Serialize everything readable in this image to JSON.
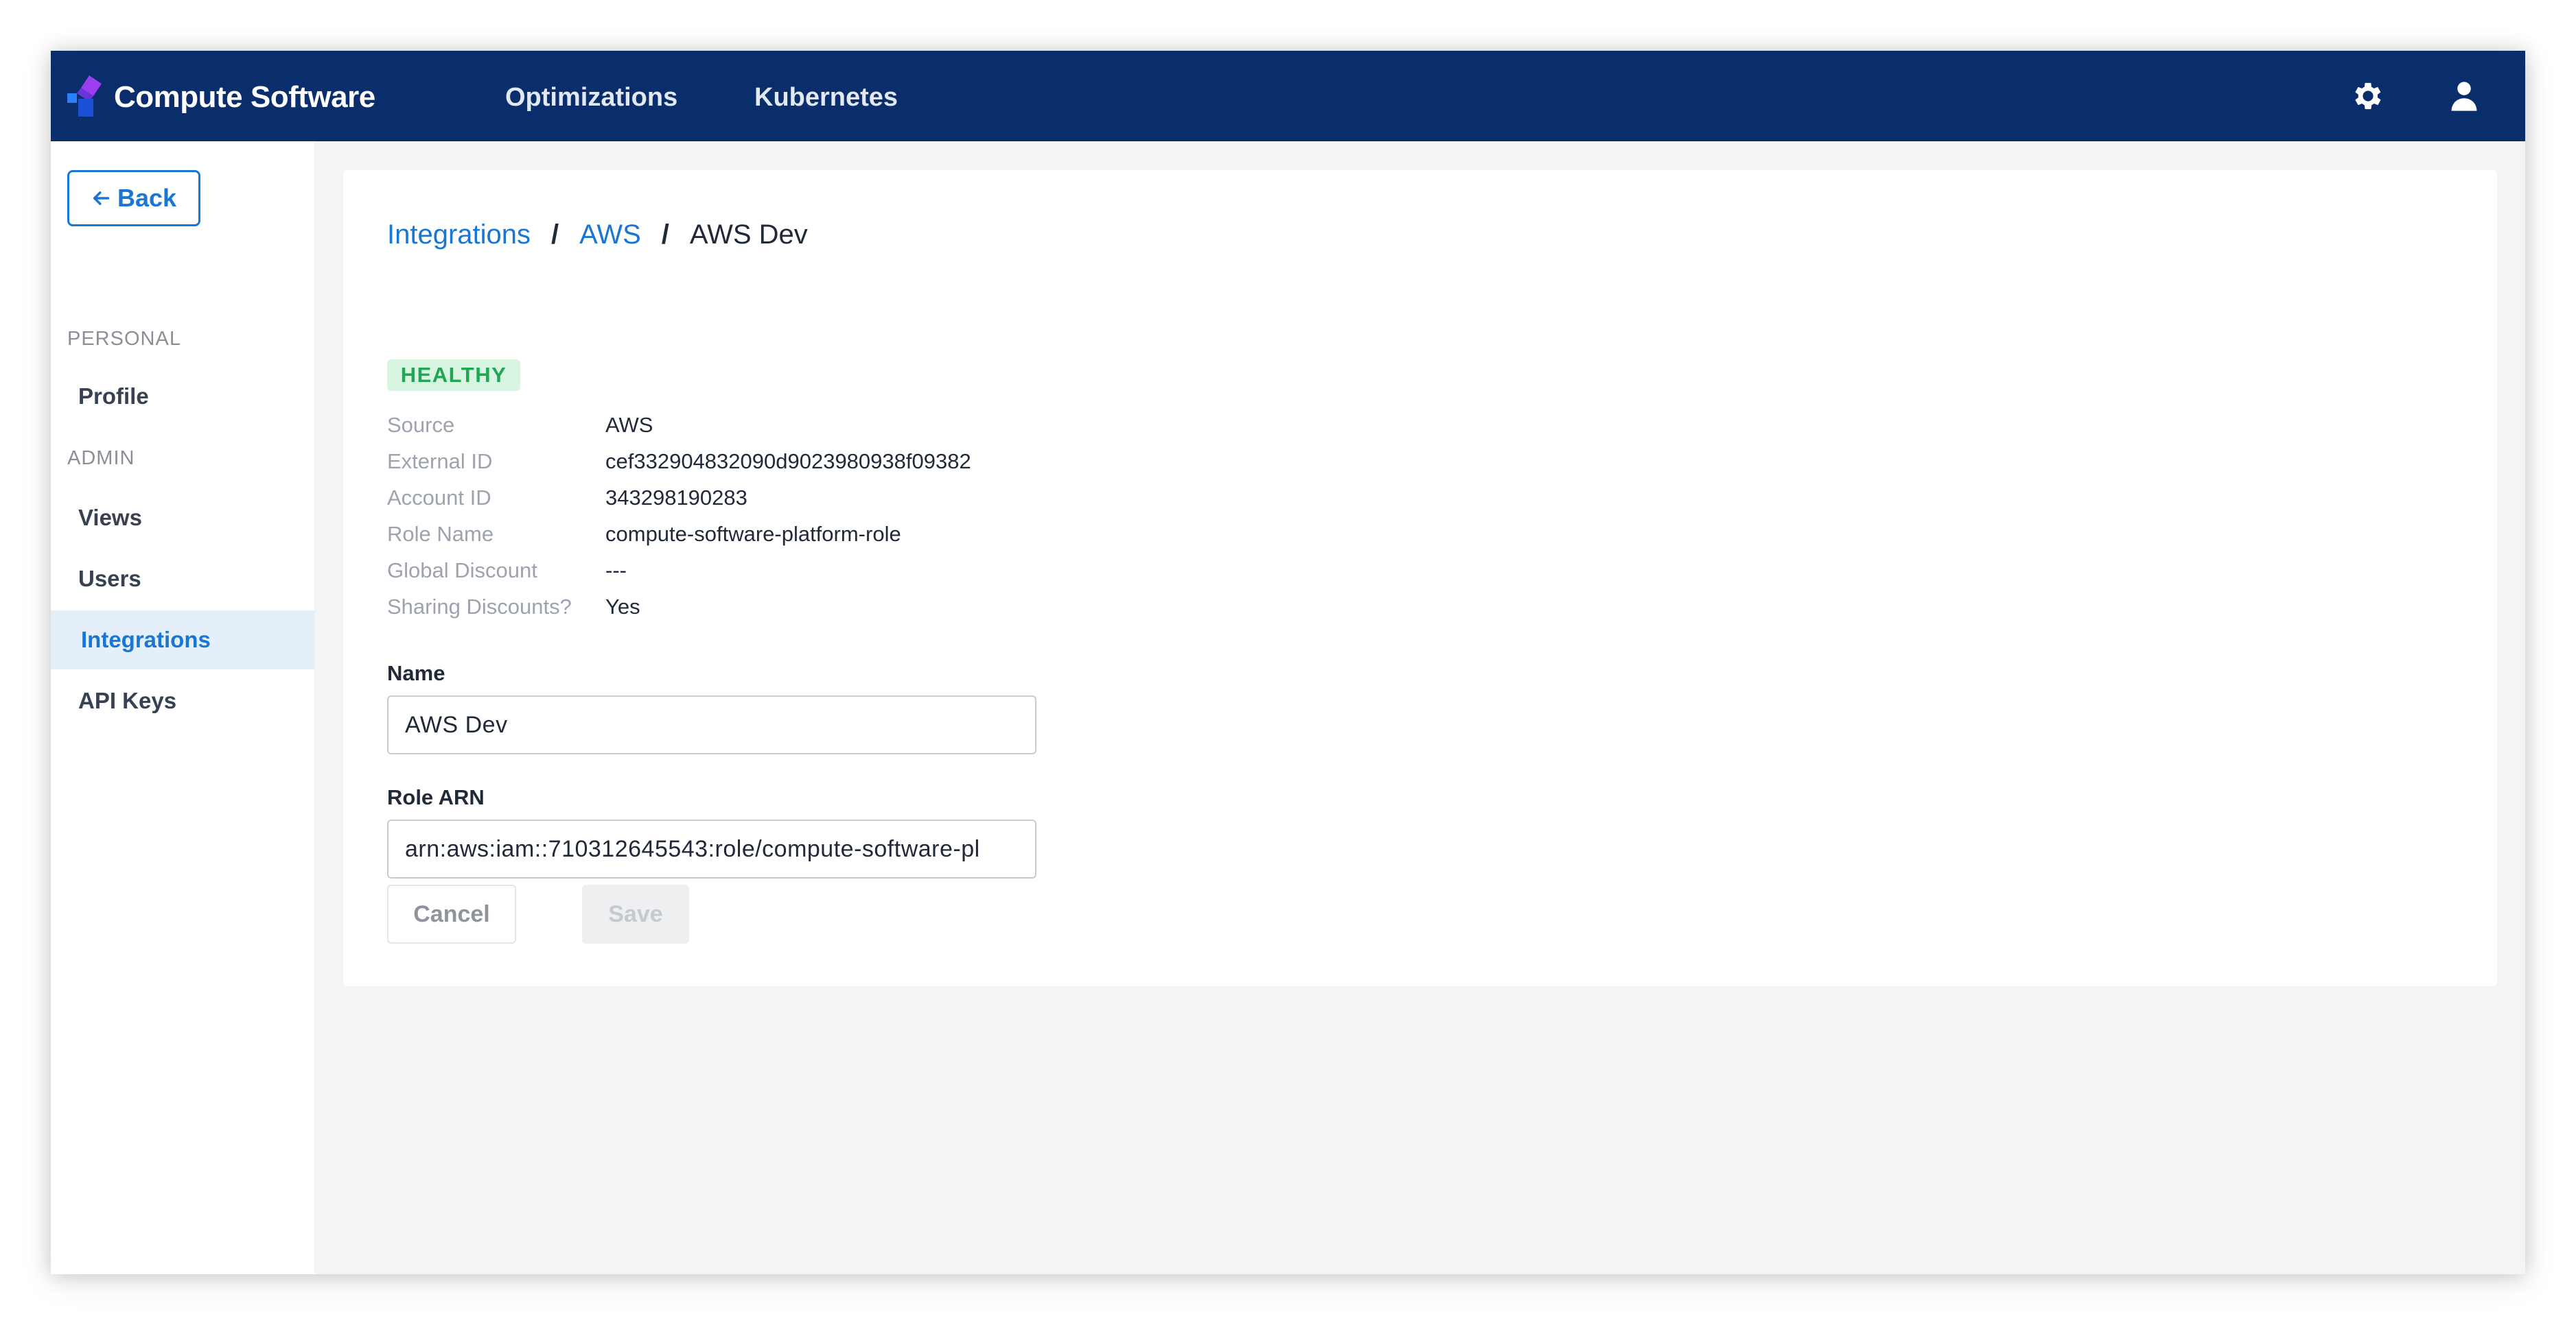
{
  "header": {
    "brand": "Compute Software",
    "nav": [
      "Optimizations",
      "Kubernetes"
    ],
    "icons": [
      "gear-icon",
      "user-icon"
    ]
  },
  "sidebar": {
    "back_label": "Back",
    "back_icon": "arrow-left-icon",
    "sections": [
      {
        "label": "PERSONAL",
        "items": [
          {
            "label": "Profile",
            "active": false
          }
        ]
      },
      {
        "label": "ADMIN",
        "items": [
          {
            "label": "Views",
            "active": false
          },
          {
            "label": "Users",
            "active": false
          },
          {
            "label": "Integrations",
            "active": true
          },
          {
            "label": "API Keys",
            "active": false
          }
        ]
      }
    ]
  },
  "breadcrumb": {
    "items": [
      "Integrations",
      "AWS"
    ],
    "separator": "/",
    "current": "AWS Dev"
  },
  "status": {
    "label": "HEALTHY",
    "color": "#22a653"
  },
  "details": [
    {
      "label": "Source",
      "value": "AWS"
    },
    {
      "label": "External ID",
      "value": "cef332904832090d9023980938f09382"
    },
    {
      "label": "Account ID",
      "value": "343298190283"
    },
    {
      "label": "Role Name",
      "value": "compute-software-platform-role"
    },
    {
      "label": "Global Discount",
      "value": "---"
    },
    {
      "label": "Sharing Discounts?",
      "value": "Yes"
    }
  ],
  "form": {
    "name": {
      "label": "Name",
      "value": "AWS Dev"
    },
    "role_arn": {
      "label": "Role ARN",
      "value": "arn:aws:iam::710312645543:role/compute-software-pl"
    }
  },
  "actions": {
    "cancel_label": "Cancel",
    "save_label": "Save",
    "save_disabled": true
  },
  "colors": {
    "topbar": "#0a2d6b",
    "accent": "#1976d2",
    "active_bg": "#e5effa"
  }
}
